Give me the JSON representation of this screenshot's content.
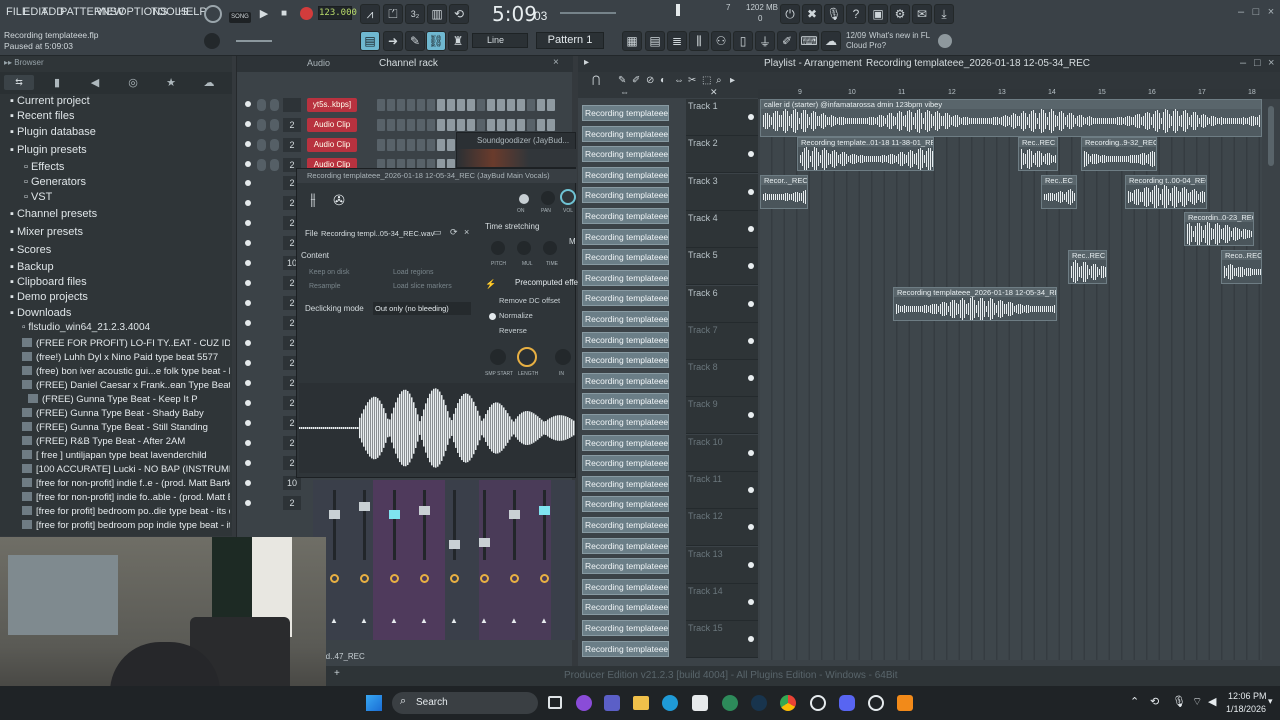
{
  "menu": {
    "file": "FILE",
    "edit": "EDIT",
    "add": "ADD",
    "patterns": "PATTERNS",
    "view": "VIEW",
    "options": "OPTIONS",
    "tools": "TOOLS",
    "help": "HELP"
  },
  "transport": {
    "song_label": "SONG",
    "tempo": "123.000",
    "time_main": "5:09",
    "time_sub": "03",
    "cpu_mem": "1202 MB",
    "cpu_polyphony": "0",
    "cpu_num": "7"
  },
  "hint": {
    "title": "Recording templateee.flp",
    "status": "Paused at 5:09:03"
  },
  "toolbar": {
    "snap_label": "Line",
    "pattern": "Pattern 1"
  },
  "news": {
    "date": "12/09",
    "line1": "What's new in FL",
    "line2": "Cloud Pro?"
  },
  "browser": {
    "title": "Browser",
    "items": [
      "Current project",
      "Recent files",
      "Plugin database",
      "Plugin presets",
      "Effects",
      "Generators",
      "VST",
      "Channel presets",
      "Mixer presets",
      "Scores",
      "Backup",
      "Clipboard files",
      "Demo projects",
      "Downloads",
      "flstudio_win64_21.2.3.4004"
    ],
    "files": [
      "(FREE FOR PROFIT) LO-FI TY..EAT - CUZ IDONT EVEN KNOW",
      "(free!) Luhh Dyl x Nino Paid type beat 5577",
      "(free) bon iver  acoustic gui...e folk type beat - laying here",
      "(FREE) Daniel Caesar x Frank..ean Type Beat - Tied To You",
      "(FREE) Gunna Type Beat - Keep It P",
      "(FREE) Gunna Type Beat - Shady Baby",
      "(FREE) Gunna Type Beat - Still Standing",
      "(FREE) R&B Type Beat - After 2AM",
      "[ free ] untiljapan type beat lavenderchild",
      "[100 ACCURATE] Lucki - NO BAP (INSTRUMENTAL)",
      "[free for non-profit] indie f..e  - (prod. Matt Bartkus)",
      "[free for non-profit] indie fo..able  - (prod. Matt Bartkus) (1)",
      "[free for profit] bedroom po..die type beat - its done (1)",
      "[free for profit] bedroom pop  indie type beat - its done"
    ]
  },
  "channel_rack": {
    "title": "Channel rack",
    "filter": "Audio",
    "channels": [
      {
        "label": "yt5s..kbps]",
        "num": ""
      },
      {
        "label": "Audio Clip",
        "num": "2"
      },
      {
        "label": "Audio Clip",
        "num": "2"
      },
      {
        "label": "Audio Clip",
        "num": "2"
      }
    ],
    "numbers": [
      "2",
      "2",
      "2",
      "2",
      "10",
      "2",
      "2",
      "2",
      "2",
      "2",
      "2",
      "2",
      "2",
      "2",
      "2",
      "10",
      "2",
      "2",
      "16"
    ],
    "bottom_label": "rd..47_REC"
  },
  "soundgoodizer": {
    "title": "Soundgoodizer (JayBud..."
  },
  "sampler": {
    "title": "Recording templateee_2026-01-18 12-05-34_REC (JayBud Main Vocals)",
    "file_label": "File",
    "file_value": "Recording templ..05-34_REC.wav",
    "content": "Content",
    "keep_on_disk": "Keep on disk",
    "load_regions": "Load regions",
    "resample": "Resample",
    "load_slice": "Load slice markers",
    "declick_label": "Declicking mode",
    "declick_value": "Out only (no bleeding)",
    "time_stretch": "Time stretching",
    "pitch": "PITCH",
    "mul": "MUL",
    "time": "TIME",
    "precomputed": "Precomputed effe",
    "remove_dc": "Remove DC offset",
    "normalize": "Normalize",
    "reverse": "Reverse",
    "smp_start": "SMP START",
    "length": "LENGTH",
    "in": "IN",
    "knob_on": "ON",
    "knob_pan": "PAN",
    "knob_vol": "VOL",
    "m_label": "M"
  },
  "playlist": {
    "title": "Playlist - Arrangement",
    "project": "Recording templateee_2026-01-18 12-05-34_REC",
    "clip_list_label": "Recording templateee_2",
    "tracks": [
      "Track 1",
      "Track 2",
      "Track 3",
      "Track 4",
      "Track 5",
      "Track 6",
      "Track 7",
      "Track 8",
      "Track 9",
      "Track 10",
      "Track 11",
      "Track 12",
      "Track 13",
      "Track 14",
      "Track 15"
    ],
    "ruler": [
      "9",
      "10",
      "11",
      "12",
      "13",
      "14",
      "15",
      "16",
      "17",
      "18"
    ],
    "clips": {
      "t1": "caller id (starter) @infamatarossa dmin 123bpm vibey",
      "t2a": "Recording template..01-18 11-38-01_REC",
      "t2b": "Rec..REC",
      "t2c": "Recording..9-32_REC",
      "t3a": "Recor.._REC",
      "t3b": "Rec..EC",
      "t3c": "Recording t..00-04_REC",
      "t4": "Recordin..0-23_REC",
      "t5a": "Rec..REC",
      "t5b": "Reco..REC",
      "t6": "Recording templateee_2026-01-18 12-05-34_REC"
    }
  },
  "status_bar": "Producer Edition v21.2.3 [build 4004] - All Plugins Edition - Windows - 64Bit",
  "taskbar": {
    "search": "Search",
    "time": "12:06 PM",
    "date": "1/18/2026"
  },
  "colors": {
    "accent_green": "#b9dc6a",
    "channel_red": "#b8323f",
    "clip_slate": "#6b7e87",
    "record_red": "#d23c3c"
  }
}
